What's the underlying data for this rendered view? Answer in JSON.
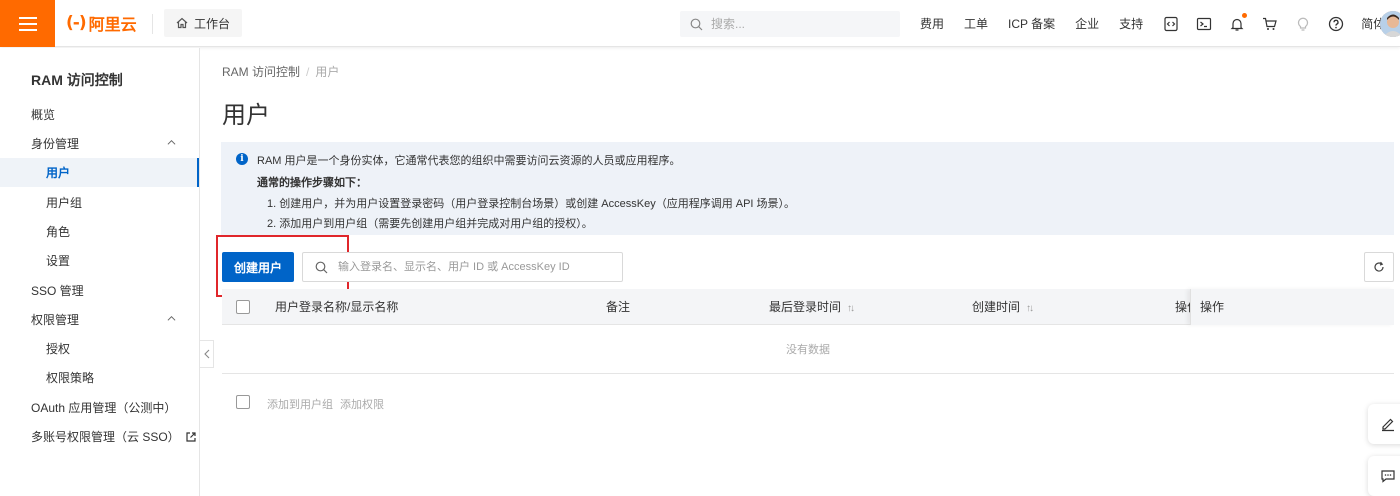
{
  "topbar": {
    "logo_text": "阿里云",
    "workbench_label": "工作台",
    "search_placeholder": "搜索...",
    "links": [
      "费用",
      "工单",
      "ICP 备案",
      "企业",
      "支持"
    ],
    "lang_label": "简体",
    "icons": [
      "code-icon",
      "terminal-icon",
      "bell-icon",
      "cart-icon",
      "bulb-icon",
      "help-icon"
    ],
    "accent": "#ff6a00"
  },
  "sidebar": {
    "title": "RAM 访问控制",
    "items": [
      {
        "label": "概览"
      },
      {
        "label": "身份管理"
      },
      {
        "label": "用户"
      },
      {
        "label": "用户组"
      },
      {
        "label": "角色"
      },
      {
        "label": "设置"
      },
      {
        "label": "SSO 管理"
      },
      {
        "label": "权限管理"
      },
      {
        "label": "授权"
      },
      {
        "label": "权限策略"
      },
      {
        "label": "OAuth 应用管理（公测中）"
      },
      {
        "label": "多账号权限管理（云 SSO）"
      }
    ],
    "active_color": "#0064c8"
  },
  "breadcrumb": {
    "root": "RAM 访问控制",
    "separator": "/",
    "current": "用户"
  },
  "page_title": "用户",
  "notice": {
    "intro": "RAM 用户是一个身份实体，它通常代表您的组织中需要访问云资源的人员或应用程序。",
    "steps_heading": "通常的操作步骤如下：",
    "step1": "1. 创建用户，并为用户设置登录密码（用户登录控制台场景）或创建 AccessKey（应用程序调用 API 场景）。",
    "step2": "2. 添加用户到用户组（需要先创建用户组并完成对用户组的授权）。"
  },
  "actions": {
    "create_label": "创建用户",
    "filter_placeholder": "输入登录名、显示名、用户 ID 或 AccessKey ID"
  },
  "table": {
    "columns": {
      "name": "用户登录名称/显示名称",
      "remark": "备注",
      "last_login": "最后登录时间",
      "created": "创建时间",
      "ops_clipped": "操作",
      "ops": "操作"
    },
    "empty_text": "没有数据",
    "batch_add_group": "添加到用户组",
    "batch_add_perm": "添加权限"
  }
}
